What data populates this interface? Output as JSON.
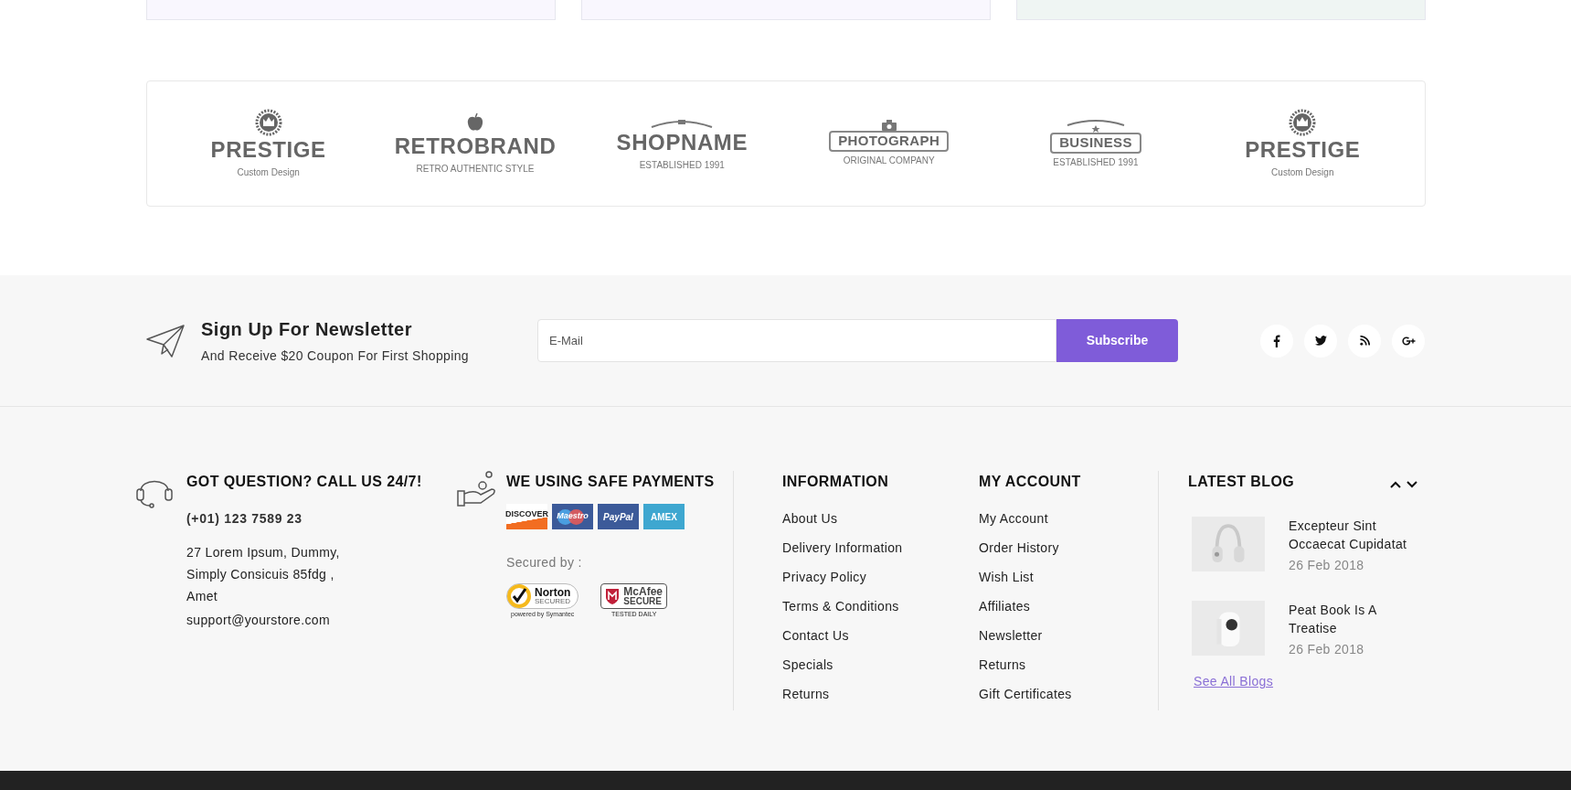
{
  "top_cards": [
    {
      "color": "#f9f7fe"
    },
    {
      "color": "#f9f7fe"
    },
    {
      "color": "#eff5f3"
    }
  ],
  "brands": [
    {
      "kind": "crown",
      "name": "PRESTIGE",
      "tagline": "Custom Design"
    },
    {
      "kind": "arch",
      "name": "RETROBRAND",
      "tagline": "RETRO AUTHENTIC STYLE"
    },
    {
      "kind": "ribbon",
      "name": "SHOPNAME",
      "tagline": "ESTABLISHED 1991"
    },
    {
      "kind": "camera",
      "name": "PHOTOGRAPH",
      "tagline": "ORIGINAL COMPANY"
    },
    {
      "kind": "badge",
      "name": "BUSINESS",
      "tagline": "ESTABLISHED 1991"
    },
    {
      "kind": "crown",
      "name": "PRESTIGE",
      "tagline": "Custom Design"
    }
  ],
  "newsletter": {
    "title": "Sign Up For Newsletter",
    "subtitle": "And Receive $20 Coupon For First Shopping",
    "placeholder": "E-Mail",
    "button": "Subscribe",
    "social": [
      {
        "kind": "facebook"
      },
      {
        "kind": "twitter"
      },
      {
        "kind": "rss"
      },
      {
        "kind": "google-plus"
      }
    ]
  },
  "contact": {
    "title": "GOT QUESTION? CALL US 24/7!",
    "phone": "(+01) 123 7589 23",
    "address": "27 Lorem Ipsum, Dummy, Simply Consicuis 85fdg , Amet",
    "email": "support@yourstore.com"
  },
  "payments": {
    "title": "WE USING SAFE PAYMENTS",
    "cards": [
      {
        "kind": "discover",
        "label": "DISCOVER"
      },
      {
        "kind": "maestro",
        "label": "Maestro"
      },
      {
        "kind": "paypal",
        "label": "PayPal"
      },
      {
        "kind": "amex",
        "label": "AMEX"
      }
    ],
    "secured_by": "Secured by :",
    "seals": [
      {
        "kind": "norton",
        "name": "Norton",
        "status": "SECURED",
        "note": "powered by Symantec"
      },
      {
        "kind": "mcafee",
        "name": "McAfee",
        "status": "SECURE",
        "note": "TESTED DAILY"
      }
    ]
  },
  "information": {
    "title": "INFORMATION",
    "links": [
      "About Us",
      "Delivery Information",
      "Privacy Policy",
      "Terms & Conditions",
      "Contact Us",
      "Specials",
      "Returns"
    ]
  },
  "my_account": {
    "title": "MY ACCOUNT",
    "links": [
      "My Account",
      "Order History",
      "Wish List",
      "Affiliates",
      "Newsletter",
      "Returns",
      "Gift Certificates"
    ]
  },
  "latest_blog": {
    "title": "LATEST BLOG",
    "posts": [
      {
        "kind": "headphones",
        "title": "Excepteur Sint Occaecat Cupidatat",
        "date": "26 Feb 2018"
      },
      {
        "kind": "camera",
        "title": "Peat Book Is A Treatise",
        "date": "26 Feb 2018"
      }
    ],
    "see_all": "See All Blogs"
  }
}
